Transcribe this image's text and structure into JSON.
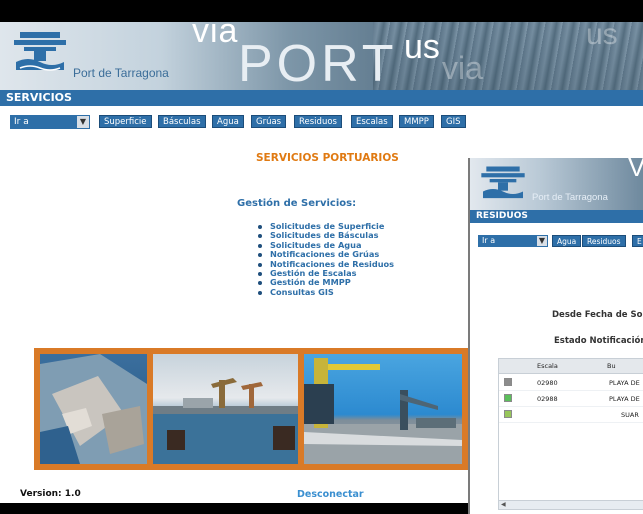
{
  "main": {
    "brand": "Port de Tarragona",
    "header_via": "via",
    "header_port": "PORT",
    "header_us": "us",
    "header_ghost_1": "us",
    "header_ghost_2": "via",
    "section_title": "SERVICIOS",
    "goto_select": "Ir a",
    "nav_buttons": [
      "Superficie",
      "Básculas",
      "Agua",
      "Grúas",
      "Residuos",
      "Escalas",
      "MMPP",
      "GIS"
    ],
    "portal_title": "SERVICIOS PORTUARIOS",
    "gestion_heading": "Gestión de Servicios:",
    "menu": [
      "Solicitudes de Superficie",
      "Solicitudes de Básculas",
      "Solicitudes de Agua",
      "Notificaciones de Grúas",
      "Notificaciones de Residuos",
      "Gestión de Escalas",
      "Gestión de MMPP",
      "Consultas GIS"
    ],
    "version": "Version:  1.0",
    "disconnect": "Desconectar"
  },
  "residuos_window": {
    "brand": "Port de Tarragona",
    "header_via": "V",
    "section_title": "RESIDUOS",
    "goto_select": "Ir a",
    "nav_buttons": [
      "Agua",
      "Residuos",
      "E"
    ],
    "filter_desde": "Desde Fecha de Solic",
    "filter_estado": "Estado Notificación",
    "grid_headers": [
      "Escala",
      "Bu"
    ],
    "rows": [
      {
        "escala": "02980",
        "buque": "PLAYA DE",
        "status_color": "#8c8c8c"
      },
      {
        "escala": "02988",
        "buque": "PLAYA DE",
        "status_color": "#5bbf5b"
      },
      {
        "escala": "",
        "buque": "SUAR",
        "status_color": "#97c65a"
      }
    ]
  }
}
